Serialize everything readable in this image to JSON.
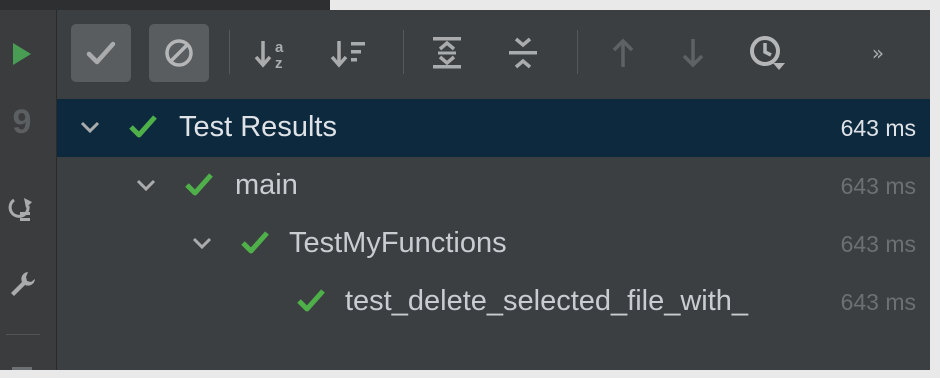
{
  "colors": {
    "accent_green": "#4fb04a",
    "selection_bg": "#0d293e",
    "panel_bg": "#3c3f41",
    "muted_text": "#6d7073",
    "run_green": "#499c54"
  },
  "gutter": {
    "icons": [
      "run-icon",
      "number-icon",
      "rerun-icon",
      "wrench-icon"
    ],
    "number_glyph": "9"
  },
  "toolbar": {
    "buttons": [
      {
        "name": "show-passed-button",
        "icon": "check-icon",
        "active": true
      },
      {
        "name": "show-ignored-button",
        "icon": "ban-icon",
        "active": true
      },
      {
        "name": "sort-alphabetically-button",
        "icon": "sort-az-icon",
        "active": false
      },
      {
        "name": "sort-by-duration-button",
        "icon": "sort-duration-icon",
        "active": false
      },
      {
        "name": "expand-all-button",
        "icon": "expand-all-icon",
        "active": false
      },
      {
        "name": "collapse-all-button",
        "icon": "collapse-all-icon",
        "active": false
      },
      {
        "name": "previous-failed-button",
        "icon": "arrow-up-icon",
        "active": false
      },
      {
        "name": "next-failed-button",
        "icon": "arrow-down-icon",
        "active": false
      },
      {
        "name": "test-history-button",
        "icon": "history-icon",
        "active": false
      },
      {
        "name": "more-button",
        "icon": "more-icon",
        "active": false
      }
    ],
    "more_label": "»"
  },
  "tree": {
    "rows": [
      {
        "label": "Test Results",
        "time": "643 ms",
        "selected": true,
        "expanded": true,
        "status": "passed"
      },
      {
        "label": "main",
        "time": "643 ms",
        "selected": false,
        "expanded": true,
        "status": "passed"
      },
      {
        "label": "TestMyFunctions",
        "time": "643 ms",
        "selected": false,
        "expanded": true,
        "status": "passed"
      },
      {
        "label": "test_delete_selected_file_with_",
        "time": "643 ms",
        "selected": false,
        "expanded": false,
        "status": "passed"
      }
    ]
  }
}
